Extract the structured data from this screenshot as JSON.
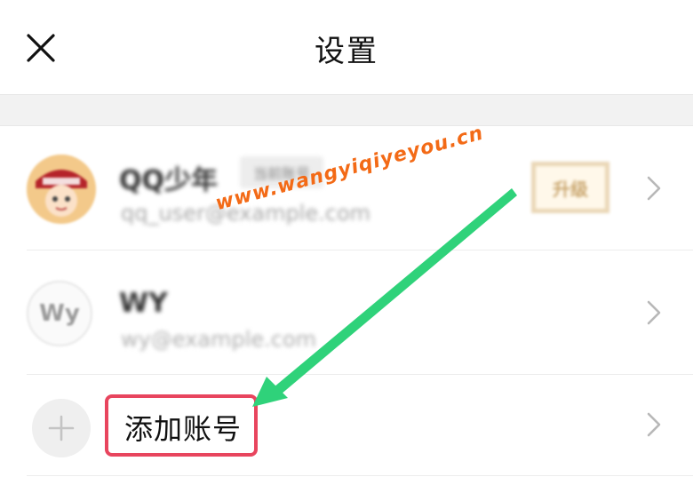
{
  "header": {
    "title": "设置",
    "close_icon": "close-icon"
  },
  "accounts": [
    {
      "name": "QQ少年",
      "badge": "当前账号",
      "email": "qq_user@example.com",
      "avatar": "cartoon-avatar",
      "tag": "升级"
    },
    {
      "name": "WY",
      "avatar_initials": "Wy",
      "email": "wy@example.com"
    }
  ],
  "add_account": {
    "label": "添加账号",
    "icon": "plus-icon"
  },
  "overlay": {
    "watermark": "www.wangyiqiyeyou.cn",
    "arrow_color": "#2fd27a",
    "highlight_color": "#e8455e",
    "watermark_color": "#f36a16"
  }
}
